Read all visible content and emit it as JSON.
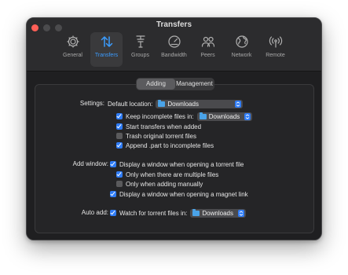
{
  "window": {
    "title": "Transfers"
  },
  "toolbar": {
    "items": [
      {
        "label": "General",
        "icon": "gear-icon"
      },
      {
        "label": "Transfers",
        "icon": "transfers-icon",
        "active": true
      },
      {
        "label": "Groups",
        "icon": "groups-icon"
      },
      {
        "label": "Bandwidth",
        "icon": "gauge-icon"
      },
      {
        "label": "Peers",
        "icon": "peers-icon"
      },
      {
        "label": "Network",
        "icon": "globe-icon"
      },
      {
        "label": "Remote",
        "icon": "antenna-icon"
      }
    ]
  },
  "tabs": [
    {
      "label": "Adding",
      "selected": true
    },
    {
      "label": "Management",
      "selected": false
    }
  ],
  "settings": {
    "label": "Settings:",
    "default_location_label": "Default location:",
    "default_location_value": "Downloads",
    "keep_incomplete": {
      "label": "Keep incomplete files in:",
      "checked": true,
      "value": "Downloads"
    },
    "start_when_added": {
      "label": "Start transfers when added",
      "checked": true
    },
    "trash_original": {
      "label": "Trash original torrent files",
      "checked": false
    },
    "append_part": {
      "label": "Append .part to incomplete files",
      "checked": true
    }
  },
  "add_window": {
    "label": "Add window:",
    "display_torrent": {
      "label": "Display a window when opening a torrent file",
      "checked": true
    },
    "only_multiple": {
      "label": "Only when there are multiple files",
      "checked": true
    },
    "only_manual": {
      "label": "Only when adding manually",
      "checked": false
    },
    "display_magnet": {
      "label": "Display a window when opening a magnet link",
      "checked": true
    }
  },
  "auto_add": {
    "label": "Auto add:",
    "watch": {
      "label": "Watch for torrent files in:",
      "checked": true,
      "value": "Downloads"
    }
  },
  "colors": {
    "accent": "#2f7cf6",
    "close": "#ff5f57",
    "folder": "#4aa3e8"
  }
}
